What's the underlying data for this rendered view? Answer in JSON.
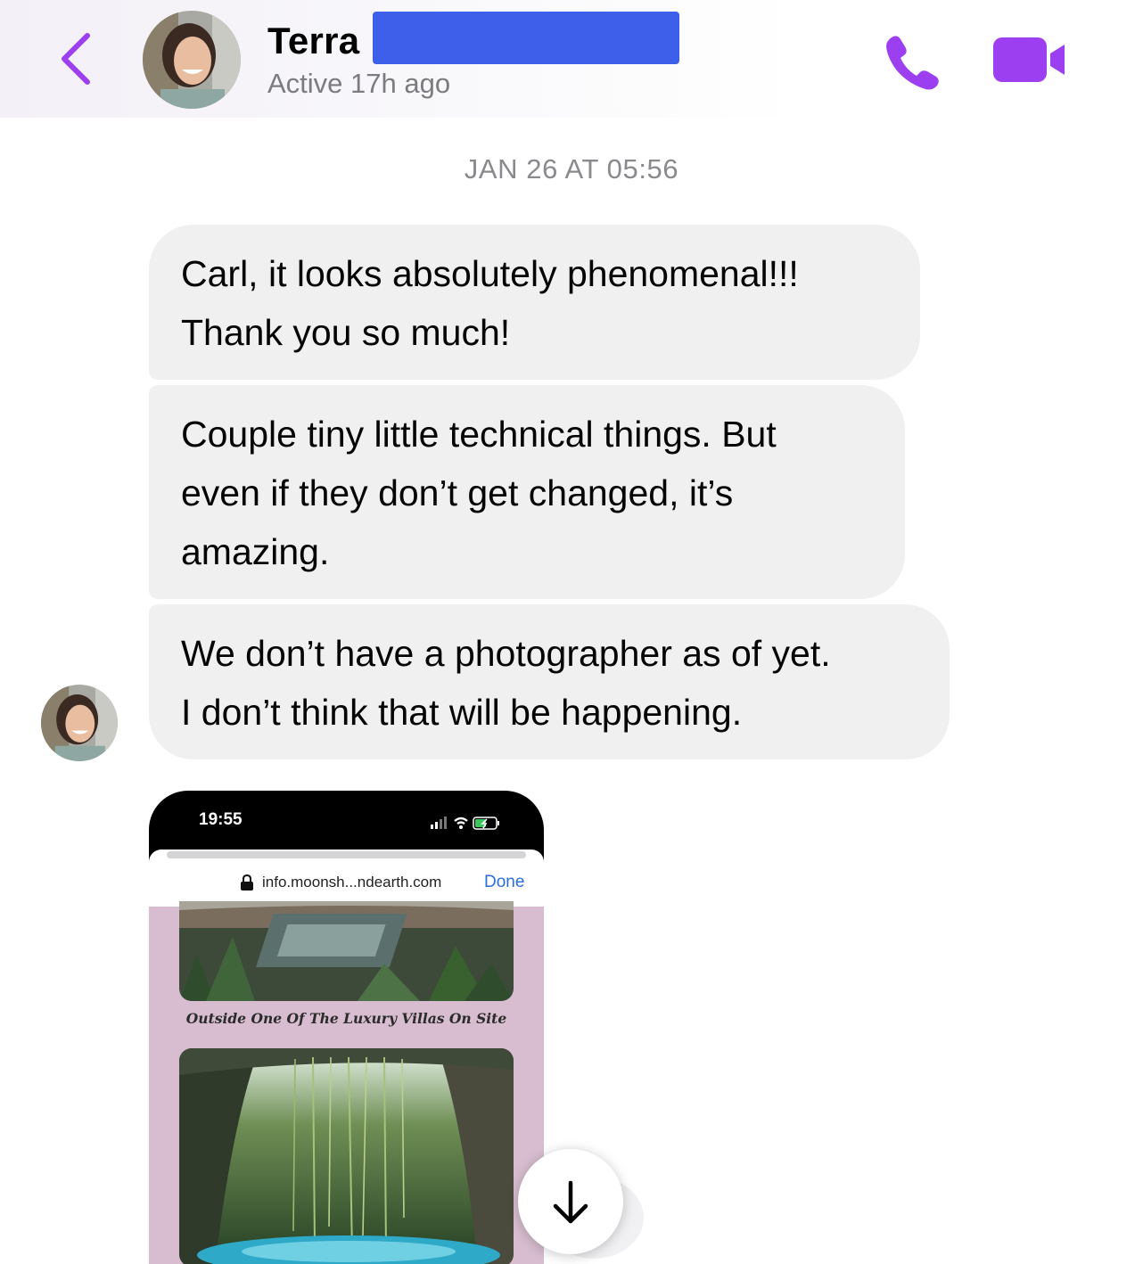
{
  "header": {
    "contact_name": "Terra",
    "status": "Active 17h ago",
    "accent_color": "#9b3ff0",
    "icons": [
      "back-chevron-icon",
      "phone-icon",
      "video-camera-icon"
    ]
  },
  "conversation": {
    "timestamp": "JAN 26 AT 05:56",
    "messages": [
      {
        "lines": [
          "Carl, it looks absolutely phenomenal!!!",
          "Thank you so much!"
        ]
      },
      {
        "lines": [
          "Couple tiny little technical things. But",
          "even if they don’t get changed, it’s",
          "amazing."
        ]
      },
      {
        "lines": [
          "We don’t have a photographer as of yet.",
          "I don’t think that will be happening."
        ]
      }
    ],
    "attachment": {
      "status_time": "19:55",
      "url": "info.moonsh...ndearth.com",
      "done_label": "Done",
      "caption": "Outside One Of The Luxury Villas On Site"
    }
  },
  "scroll_button": {
    "icon": "arrow-down-icon"
  }
}
